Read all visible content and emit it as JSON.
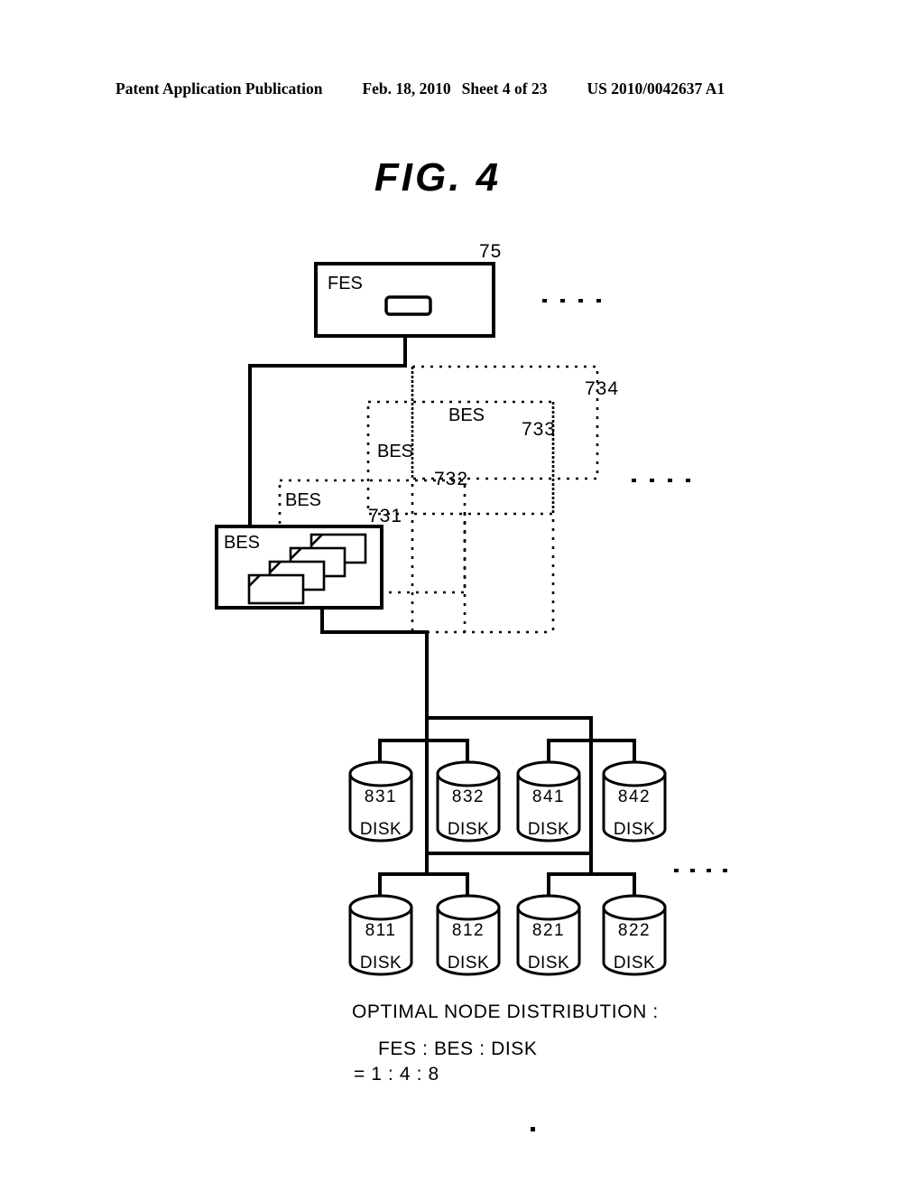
{
  "header": {
    "title": "Patent Application Publication",
    "date": "Feb. 18, 2010",
    "sheet": "Sheet 4 of 23",
    "doc_number": "US 2010/0042637 A1"
  },
  "figure": {
    "title": "FIG.  4",
    "fes": {
      "label": "FES",
      "ref": "75"
    },
    "bes_stack": [
      {
        "label": "BES",
        "ref": "731"
      },
      {
        "label": "BES",
        "ref": "732"
      },
      {
        "label": "BES",
        "ref": "733"
      },
      {
        "label": "BES",
        "ref": "734"
      }
    ],
    "disks_top": [
      {
        "id": "831",
        "word": "DISK"
      },
      {
        "id": "832",
        "word": "DISK"
      },
      {
        "id": "841",
        "word": "DISK"
      },
      {
        "id": "842",
        "word": "DISK"
      }
    ],
    "disks_bottom": [
      {
        "id": "811",
        "word": "DISK"
      },
      {
        "id": "812",
        "word": "DISK"
      },
      {
        "id": "821",
        "word": "DISK"
      },
      {
        "id": "822",
        "word": "DISK"
      }
    ],
    "caption": {
      "line1": "OPTIMAL NODE DISTRIBUTION :",
      "line2": "FES : BES : DISK",
      "line3": "=  1  :  4  :  8"
    },
    "colors": {
      "ink": "#000000",
      "paper": "#ffffff"
    }
  }
}
